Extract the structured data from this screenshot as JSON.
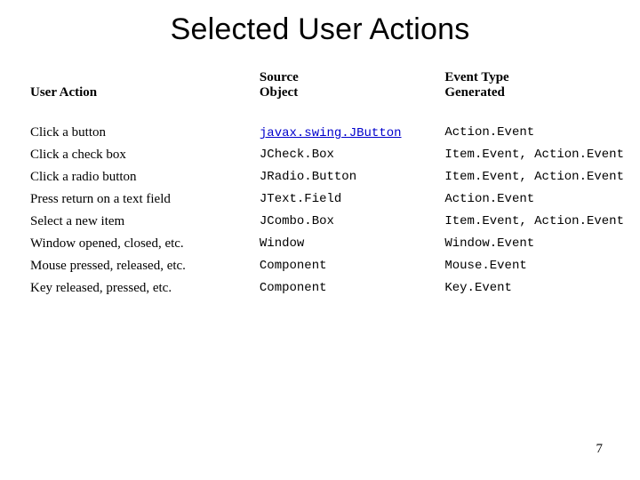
{
  "title": "Selected User Actions",
  "headers": {
    "action": "User Action",
    "source_l1": "Source",
    "source_l2": "Object",
    "event_l1": "Event Type",
    "event_l2": "Generated"
  },
  "rows": [
    {
      "action": "Click a button",
      "source": "javax.swing.JButton",
      "source_link": true,
      "event": "Action.Event"
    },
    {
      "action": "Click a check box",
      "source": "JCheck.Box",
      "source_link": false,
      "event": "Item.Event, Action.Event"
    },
    {
      "action": "Click a radio button",
      "source": "JRadio.Button",
      "source_link": false,
      "event": "Item.Event, Action.Event"
    },
    {
      "action": "Press return on a text field",
      "source": "JText.Field",
      "source_link": false,
      "event": "Action.Event"
    },
    {
      "action": "Select a new item",
      "source": "JCombo.Box",
      "source_link": false,
      "event": "Item.Event, Action.Event"
    },
    {
      "action": "Window opened, closed, etc.",
      "source": "Window",
      "source_link": false,
      "event": "Window.Event"
    },
    {
      "action": "Mouse pressed, released, etc.",
      "source": "Component",
      "source_link": false,
      "event": "Mouse.Event"
    },
    {
      "action": "Key released, pressed, etc.",
      "source": "Component",
      "source_link": false,
      "event": "Key.Event"
    }
  ],
  "page_number": "7"
}
